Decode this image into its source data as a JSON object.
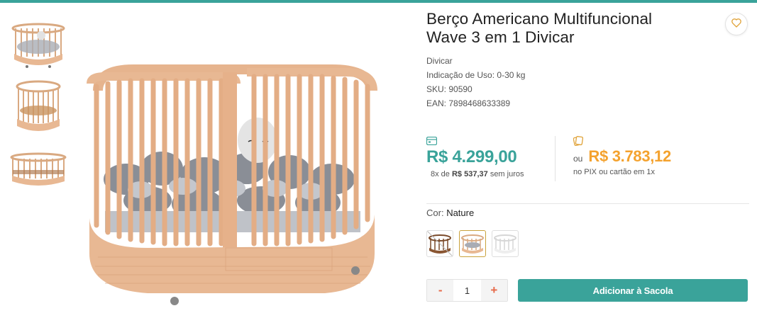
{
  "product": {
    "title": "Berço Americano Multifuncional Wave 3 em 1 Divicar",
    "brand": "Divicar",
    "usage": "Indicação de Uso: 0-30 kg",
    "sku": "SKU: 90590",
    "ean": "EAN: 7898468633389"
  },
  "icons": {
    "favorite": "heart-icon",
    "card": "credit-card-icon",
    "pix": "pix-icon"
  },
  "pricing": {
    "card_price": "R$ 4.299,00",
    "installments_prefix": "8x de",
    "installments_value": "R$ 537,37",
    "installments_suffix": "sem juros",
    "pix_or": "ou",
    "pix_price": "R$ 3.783,12",
    "pix_note": "no PIX ou cartão em 1x"
  },
  "variation": {
    "label": "Cor:",
    "selected": "Nature",
    "options": [
      "Walnut",
      "Nature",
      "White"
    ]
  },
  "cart": {
    "minus": "-",
    "quantity": "1",
    "plus": "+",
    "add_label": "Adicionar à Sacola"
  },
  "colors": {
    "accent": "#3aa39a",
    "pix": "#f4a22e",
    "qty_buttons": "#e66a4a",
    "wood": "#e8b893"
  }
}
